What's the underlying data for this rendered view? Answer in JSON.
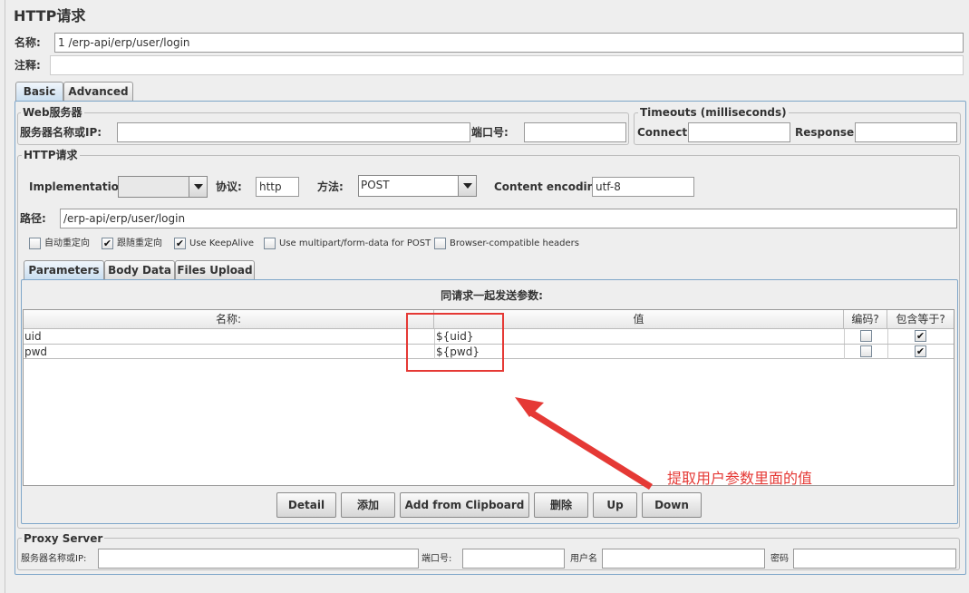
{
  "title": "HTTP请求",
  "name_label": "名称:",
  "name_value": "1 /erp-api/erp/user/login",
  "comment_label": "注释:",
  "comment_value": "",
  "tabs": [
    {
      "label": "Basic",
      "active": true
    },
    {
      "label": "Advanced",
      "active": false
    }
  ],
  "web_server": {
    "title": "Web服务器",
    "server_label": "服务器名称或IP:",
    "server_value": "",
    "port_label": "端口号:",
    "port_value": ""
  },
  "timeouts": {
    "title": "Timeouts (milliseconds)",
    "connect_label": "Connect:",
    "connect_value": "",
    "response_label": "Response:",
    "response_value": ""
  },
  "http_request": {
    "title": "HTTP请求",
    "implementation_label": "Implementation:",
    "implementation_value": "",
    "protocol_label": "协议:",
    "protocol_value": "http",
    "method_label": "方法:",
    "method_value": "POST",
    "encoding_label": "Content encoding:",
    "encoding_value": "utf-8",
    "path_label": "路径:",
    "path_value": "/erp-api/erp/user/login"
  },
  "options": [
    {
      "label": "自动重定向",
      "checked": false
    },
    {
      "label": "跟随重定向",
      "checked": true
    },
    {
      "label": "Use KeepAlive",
      "checked": true
    },
    {
      "label": "Use multipart/form-data for POST",
      "checked": false
    },
    {
      "label": "Browser-compatible headers",
      "checked": false
    }
  ],
  "sub_tabs": [
    {
      "label": "Parameters",
      "active": true
    },
    {
      "label": "Body Data",
      "active": false
    },
    {
      "label": "Files Upload",
      "active": false
    }
  ],
  "params_table": {
    "caption": "同请求一起发送参数:",
    "headers": [
      "名称:",
      "值",
      "编码?",
      "包含等于?"
    ],
    "rows": [
      {
        "name": "uid",
        "value": "${uid}",
        "encode": false,
        "include_equals": true
      },
      {
        "name": "pwd",
        "value": "${pwd}",
        "encode": false,
        "include_equals": true
      }
    ]
  },
  "annotation": {
    "text": "提取用户参数里面的值",
    "color": "#e53935"
  },
  "buttons": [
    "Detail",
    "添加",
    "Add from Clipboard",
    "删除",
    "Up",
    "Down"
  ],
  "proxy": {
    "title": "Proxy Server",
    "server_label": "服务器名称或IP:",
    "server_value": "",
    "port_label": "端口号:",
    "port_value": "",
    "user_label": "用户名",
    "user_value": "",
    "password_label": "密码",
    "password_value": ""
  },
  "colors": {
    "accent": "#7ea6c9",
    "annotation": "#e53935"
  }
}
